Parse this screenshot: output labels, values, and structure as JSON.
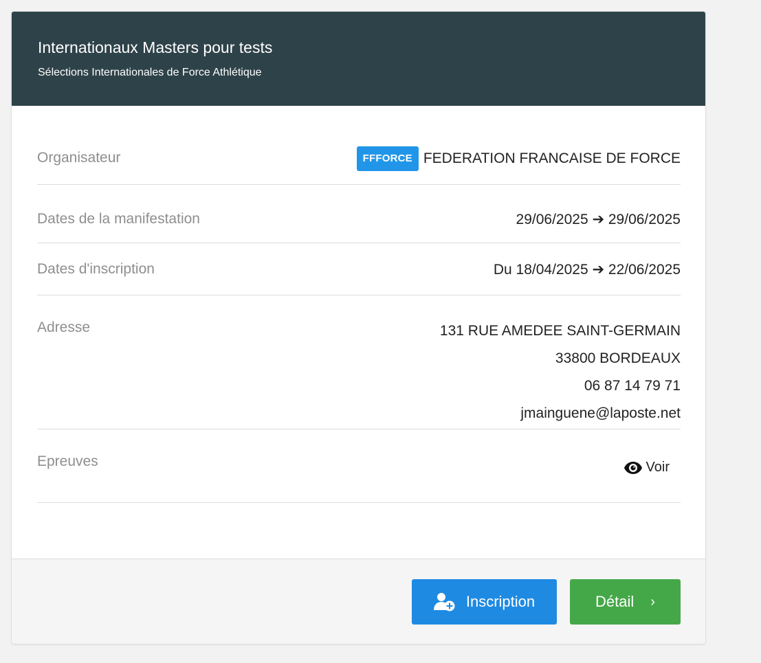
{
  "header": {
    "title": "Internationaux Masters pour tests",
    "subtitle": "Sélections Internationales de Force Athlétique"
  },
  "rows": {
    "organisateur": {
      "label": "Organisateur",
      "badge": "FFFORCE",
      "value": "FEDERATION FRANCAISE DE FORCE"
    },
    "dates_manifestation": {
      "label": "Dates de la manifestation",
      "value": "29/06/2025 ➔ 29/06/2025"
    },
    "dates_inscription": {
      "label": "Dates d'inscription",
      "value": "Du 18/04/2025 ➔ 22/06/2025"
    },
    "adresse": {
      "label": "Adresse",
      "street": "131 RUE AMEDEE SAINT-GERMAIN",
      "city": "33800 BORDEAUX",
      "phone": "06 87 14 79 71",
      "email": "jmainguene@laposte.net"
    },
    "epreuves": {
      "label": "Epreuves",
      "link_label": "Voir",
      "icon": "eye-icon"
    }
  },
  "footer": {
    "inscription_label": "Inscription",
    "inscription_icon": "user-add-icon",
    "detail_label": "Détail",
    "detail_chevron": "›"
  },
  "colors": {
    "header_bg": "#2e4249",
    "badge_bg": "#2196e8",
    "inscription_bg": "#1f8ae2",
    "detail_bg": "#45a848"
  }
}
